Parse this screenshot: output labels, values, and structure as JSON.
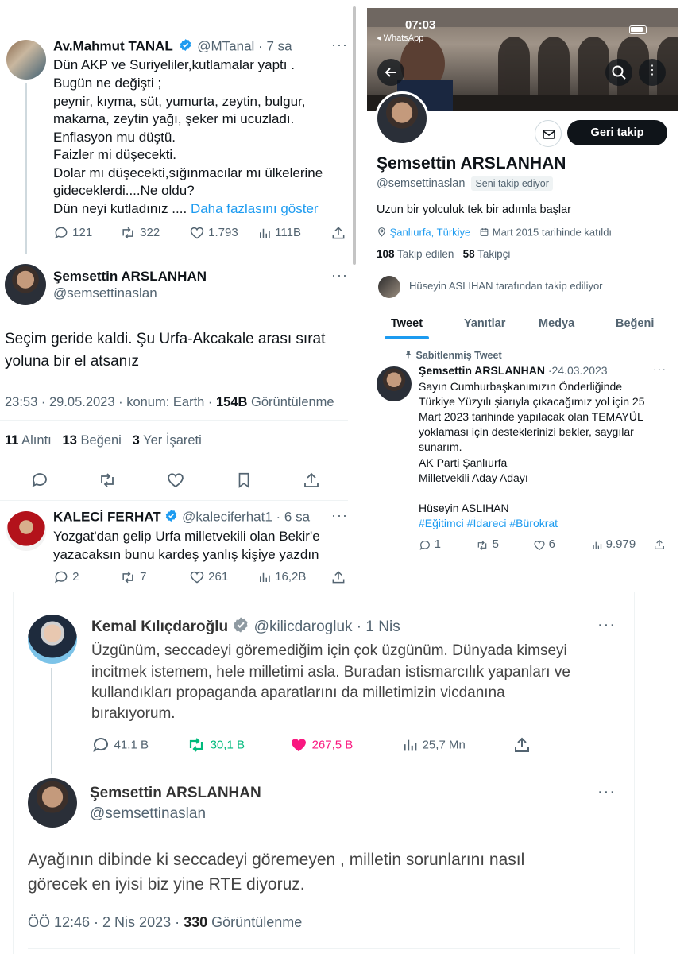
{
  "panel1": {
    "author": "Av.Mahmut TANAL",
    "handle": "@MTanal",
    "time": "7 sa",
    "lines": [
      "Dün AKP ve Suriyeliler,kutlamalar yaptı .",
      "Bugün ne değişti ;",
      "peynir, kıyma, süt, yumurta, zeytin, bulgur,",
      "makarna, zeytin yağı, şeker mi ucuzladı.",
      "Enflasyon mu düştü.",
      "Faizler mi düşecekti.",
      "Dolar mı düşecekti,sığınmacılar mı ülkelerine",
      "gideceklerdi....Ne oldu?",
      "Dün neyi kutladınız ...."
    ],
    "show_more": "Daha fazlasını göster",
    "stats": {
      "replies": "121",
      "retweets": "322",
      "likes": "1.793",
      "views": "111B"
    },
    "reply_author": "Şemsettin ARSLANHAN",
    "reply_handle": "@semsettinaslan",
    "reply_lines": [
      "Seçim geride kaldi. Şu Urfa-Akcakale arası sırat",
      "yoluna bir el atsanız"
    ],
    "meta_time": "23:53 · 29.05.2023 · konum: Earth ·",
    "meta_views_num": "154B",
    "meta_views_label": "Görüntülenme",
    "q_num": "11",
    "q_label": "Alıntı",
    "l_num": "13",
    "l_label": "Beğeni",
    "b_num": "3",
    "b_label": "Yer İşareti",
    "ferhat_name": "KALECİ FERHAT",
    "ferhat_handle": "@kaleciferhat1",
    "ferhat_time": "6 sa",
    "ferhat_lines": [
      "Yozgat'dan gelip Urfa milletvekili olan Bekir'e",
      "yazacaksın bunu kardeş yanlış kişiye yazdın"
    ],
    "ferhat_stats": {
      "replies": "2",
      "retweets": "7",
      "likes": "261",
      "views": "16,2B"
    }
  },
  "panel2": {
    "status_time": "07:03",
    "back_app": "◂ WhatsApp",
    "follow_back": "Geri takip",
    "name": "Şemsettin ARSLANHAN",
    "handle": "@semsettinaslan",
    "follows_you": "Seni takip ediyor",
    "bio": "Uzun bir yolculuk tek bir adımla başlar",
    "location": "Şanlıurfa, Türkiye",
    "joined": "Mart 2015 tarihinde katıldı",
    "following_num": "108",
    "following_label": "Takip edilen",
    "followers_num": "58",
    "followers_label": "Takipçi",
    "followed_by": "Hüseyin ASLIHAN tarafından takip ediliyor",
    "tabs": [
      "Tweet",
      "Yanıtlar",
      "Medya",
      "Beğeni"
    ],
    "pinned_label": "Sabitlenmiş Tweet",
    "pinned_author": "Şemsettin ARSLANHAN",
    "pinned_date": "24.03.2023",
    "pinned_lines": [
      "Sayın Cumhurbaşkanımızın Önderliğinde",
      "Türkiye Yüzyılı şiarıyla çıkacağımız yol için 25",
      "Mart 2023 tarihinde yapılacak olan TEMAYÜL",
      "yoklaması için desteklerinizi bekler, saygılar",
      "sunarım.",
      "AK Parti Şanlıurfa",
      "Milletvekili Aday Adayı",
      "",
      "Hüseyin ASLIHAN"
    ],
    "hashtags": "#Eğitimci #İdareci #Bürokrat",
    "stats": {
      "replies": "1",
      "retweets": "5",
      "likes": "6",
      "views": "9.979"
    }
  },
  "panel3": {
    "author": "Kemal Kılıçdaroğlu",
    "handle": "@kilicdarogluk",
    "time": "1 Nis",
    "lines": [
      "Üzgünüm, seccadeyi göremediğim için çok üzgünüm. Dünyada kimseyi",
      "incitmek istemem, hele milletimi asla. Buradan istismarcılık yapanları ve",
      "kullandıkları propaganda aparatlarını da milletimizin vicdanına",
      "bırakıyorum."
    ],
    "stats": {
      "replies": "41,1 B",
      "retweets": "30,1 B",
      "likes": "267,5 B",
      "views": "25,7 Mn"
    },
    "reply_author": "Şemsettin ARSLANHAN",
    "reply_handle": "@semsettinaslan",
    "reply_lines": [
      "Ayağının dibinde ki seccadeyi göremeyen , milletin sorunlarını nasıl",
      "görecek en iyisi biz yine RTE diyoruz."
    ],
    "meta_time": "ÖÖ 12:46 · 2 Nis 2023 ·",
    "meta_views_num": "330",
    "meta_views_label": "Görüntülenme"
  },
  "colors": {
    "accent": "#1d9bf0",
    "retweet": "#00ba7c",
    "like": "#f91880",
    "text": "#0f1419",
    "secondary": "#536471"
  }
}
